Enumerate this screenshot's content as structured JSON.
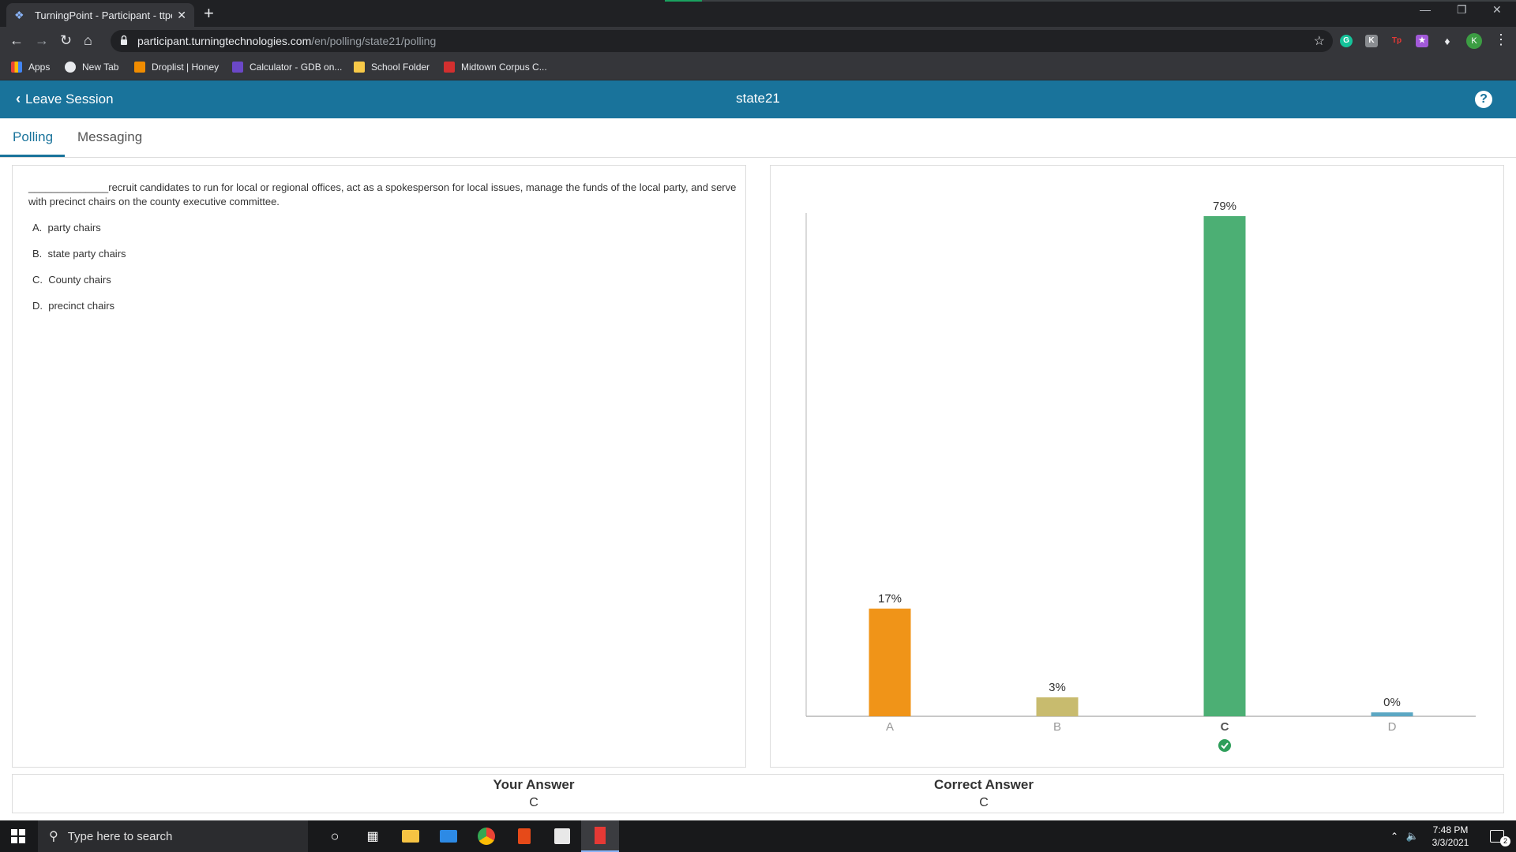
{
  "browser": {
    "tab_title": "TurningPoint - Participant - ttpoll",
    "url_host": "participant.turningtechnologies.com",
    "url_path": "/en/polling/state21/polling",
    "bookmarks": [
      "Apps",
      "New Tab",
      "Droplist | Honey",
      "Calculator - GDB on...",
      "School Folder",
      "Midtown Corpus C..."
    ],
    "profile_initial": "K"
  },
  "app": {
    "leave_label": "Leave Session",
    "session_name": "state21",
    "help_label": "?",
    "tabs": [
      "Polling",
      "Messaging"
    ],
    "active_tab": "Polling"
  },
  "question": {
    "blank": "______________",
    "text": "recruit candidates to run for local or regional offices, act as a spokesperson for local issues, manage the funds of the local party, and serve with precinct chairs on the county executive committee.",
    "options": [
      {
        "letter": "A.",
        "text": "party chairs"
      },
      {
        "letter": "B.",
        "text": "state party chairs"
      },
      {
        "letter": "C.",
        "text": "County chairs"
      },
      {
        "letter": "D.",
        "text": "precinct chairs"
      }
    ]
  },
  "chart_data": {
    "type": "bar",
    "categories": [
      "A",
      "B",
      "C",
      "D"
    ],
    "values": [
      17,
      3,
      79,
      0
    ],
    "labels": [
      "17%",
      "3%",
      "79%",
      "0%"
    ],
    "colors": [
      "#f09418",
      "#c8bb6e",
      "#4caf74",
      "#5ba7c3"
    ],
    "correct": "C",
    "ylim": [
      0,
      79
    ],
    "title": "",
    "xlabel": "",
    "ylabel": ""
  },
  "answers": {
    "your_label": "Your Answer",
    "your_value": "C",
    "correct_label": "Correct Answer",
    "correct_value": "C"
  },
  "taskbar": {
    "search_placeholder": "Type here to search",
    "time": "7:48 PM",
    "date": "3/3/2021",
    "notification_count": "2"
  },
  "colors": {
    "header": "#19739b",
    "accent": "#19739b",
    "correct_check": "#2e9e5a"
  }
}
